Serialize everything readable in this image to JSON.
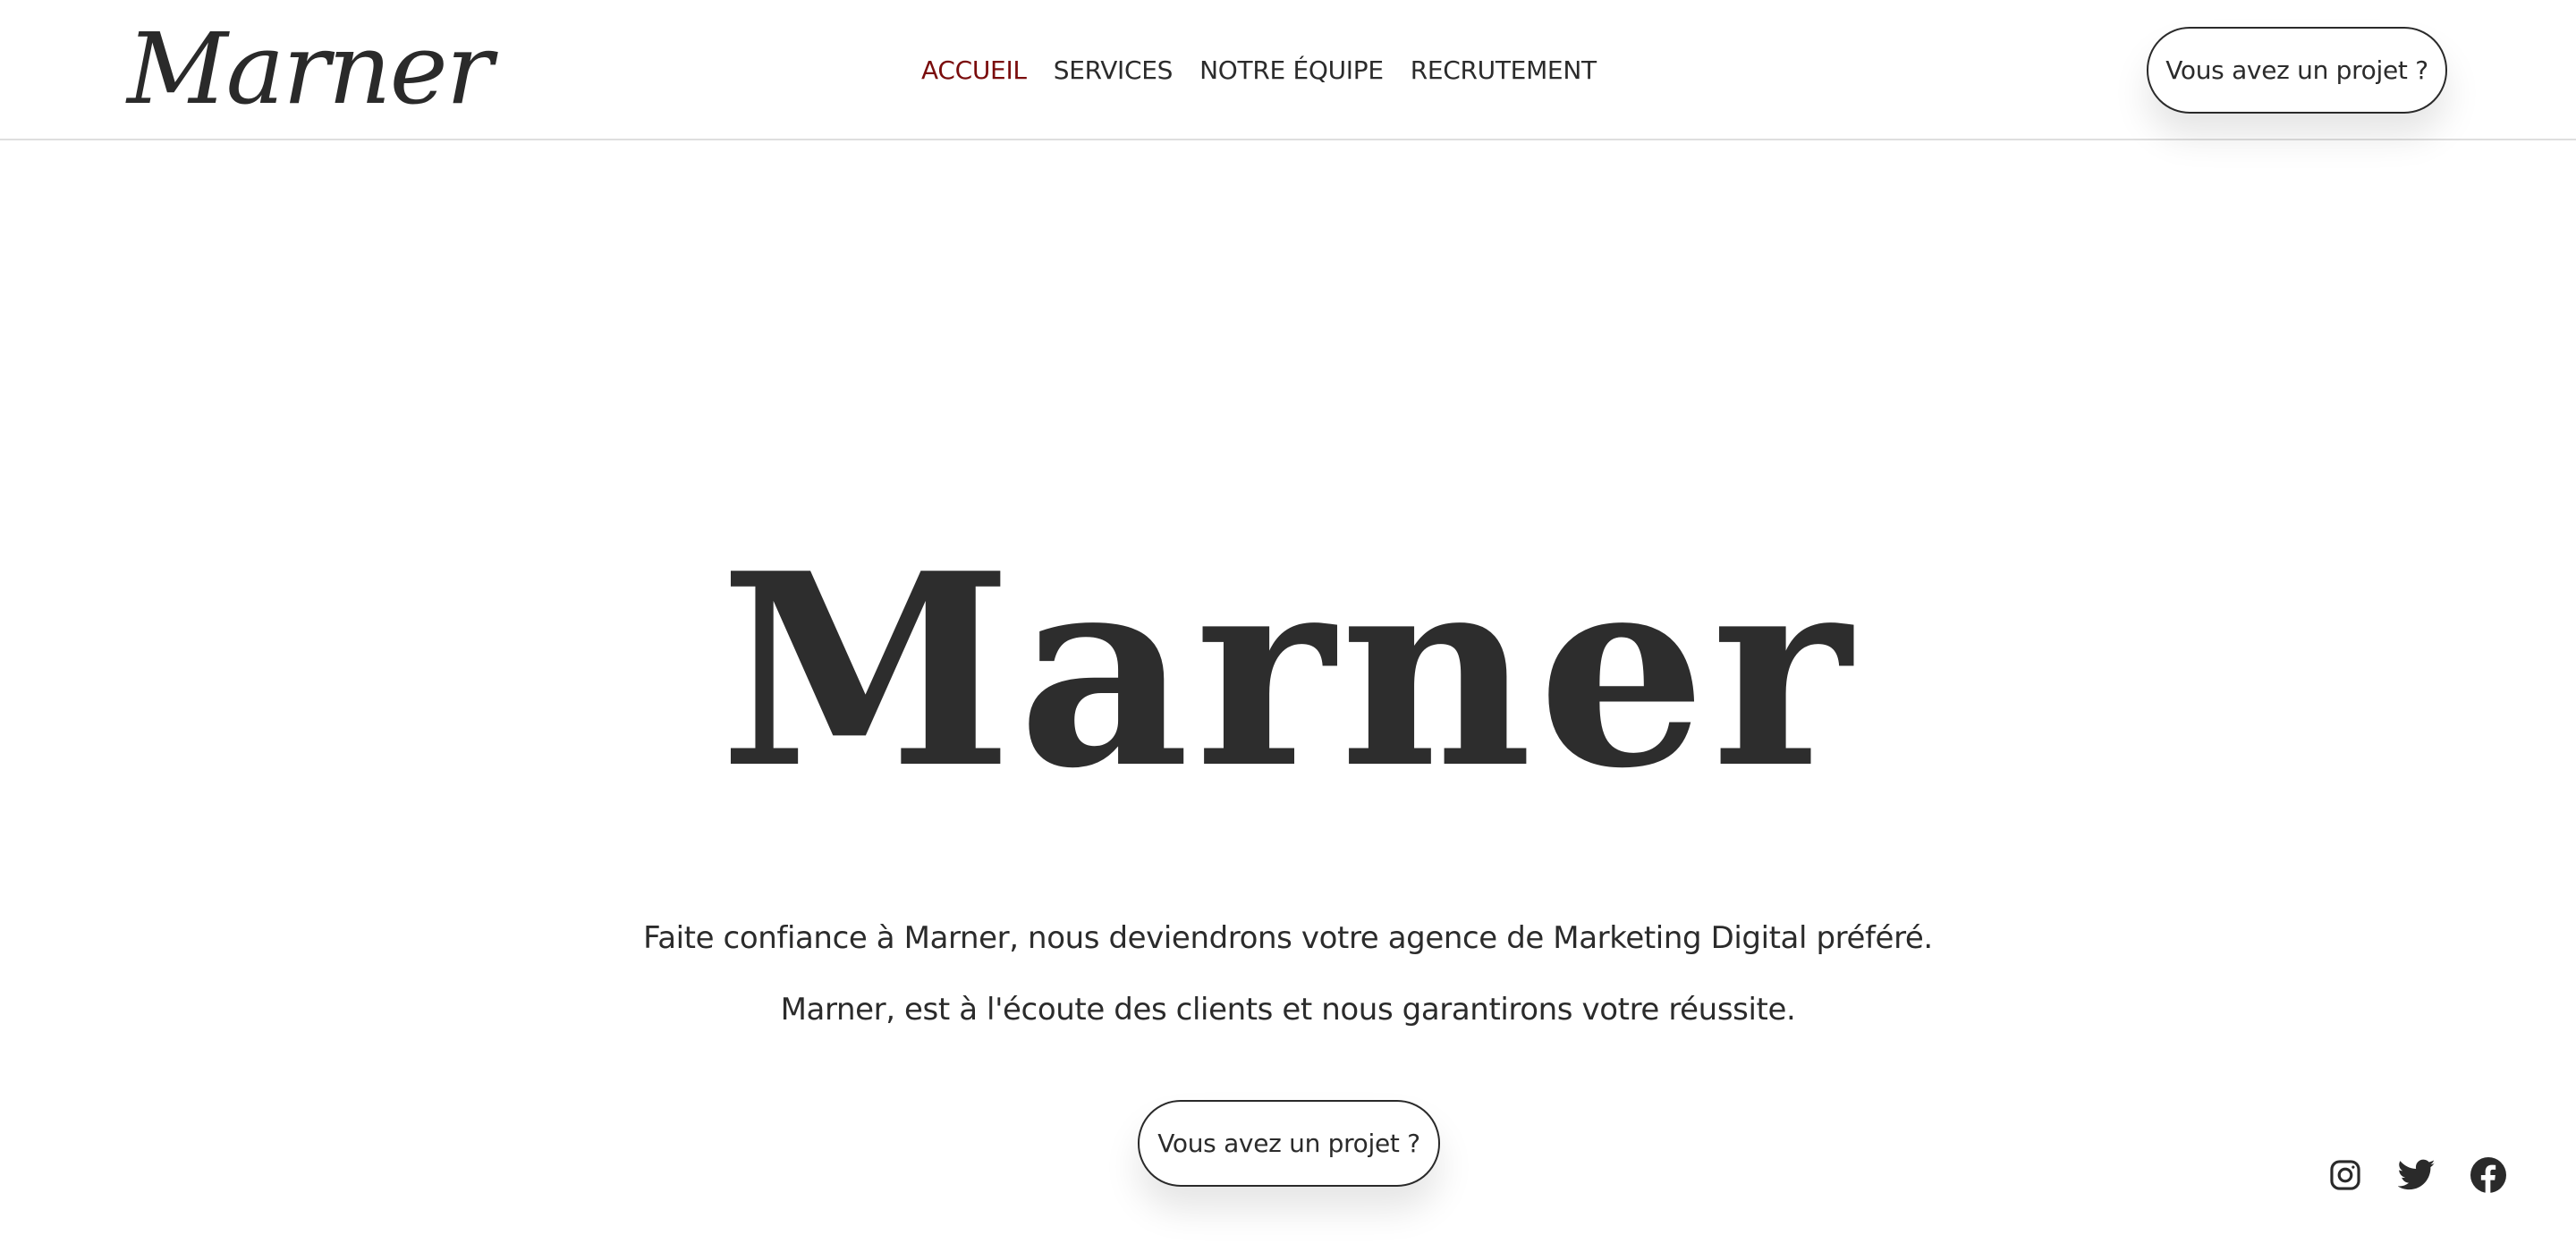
{
  "brand": {
    "logo_text": "Marner",
    "accent_color": "#7a0c0c",
    "text_color": "#2b2b2b"
  },
  "nav": {
    "items": [
      {
        "label": "ACCUEIL",
        "active": true
      },
      {
        "label": "SERVICES",
        "active": false
      },
      {
        "label": "NOTRE ÉQUIPE",
        "active": false
      },
      {
        "label": "RECRUTEMENT",
        "active": false
      }
    ]
  },
  "header": {
    "cta_label": "Vous avez un projet ?"
  },
  "hero": {
    "title": "Marner",
    "line1": "Faite confiance à Marner, nous deviendrons votre agence de Marketing Digital préféré.",
    "line2": "Marner, est à l'écoute des clients et nous garantirons votre réussite.",
    "cta_label": "Vous avez un projet ?"
  },
  "socials": [
    {
      "icon": "instagram-icon"
    },
    {
      "icon": "twitter-icon"
    },
    {
      "icon": "facebook-icon"
    }
  ]
}
